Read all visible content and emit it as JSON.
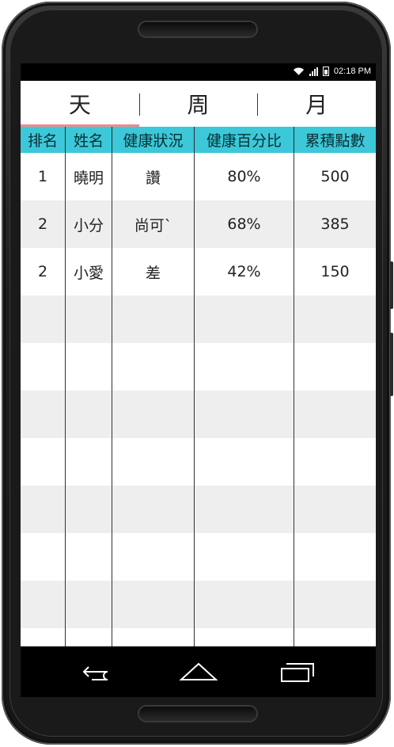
{
  "status_bar": {
    "time": "02:18 PM",
    "icons": [
      "wifi-icon",
      "signal-icon",
      "battery-icon"
    ]
  },
  "tabs": [
    {
      "label": "天",
      "active": true
    },
    {
      "label": "周",
      "active": false
    },
    {
      "label": "月",
      "active": false
    }
  ],
  "table": {
    "headers": [
      "排名",
      "姓名",
      "健康狀況",
      "健康百分比",
      "累積點數"
    ],
    "rows": [
      [
        "1",
        "曉明",
        "讚",
        "80%",
        "500"
      ],
      [
        "2",
        "小分",
        "尚可`",
        "68%",
        "385"
      ],
      [
        "2",
        "小愛",
        "差",
        "42%",
        "150"
      ],
      [
        "",
        "",
        "",
        "",
        ""
      ],
      [
        "",
        "",
        "",
        "",
        ""
      ],
      [
        "",
        "",
        "",
        "",
        ""
      ],
      [
        "",
        "",
        "",
        "",
        ""
      ],
      [
        "",
        "",
        "",
        "",
        ""
      ],
      [
        "",
        "",
        "",
        "",
        ""
      ],
      [
        "",
        "",
        "",
        "",
        ""
      ],
      [
        "",
        "",
        "",
        "",
        ""
      ]
    ]
  },
  "nav_bar": {
    "buttons": [
      "back-icon",
      "home-icon",
      "recents-icon"
    ]
  },
  "colors": {
    "header_bg": "#3cc8d8",
    "tab_indicator": "#f28b8b",
    "row_alt": "#eeeeee"
  }
}
